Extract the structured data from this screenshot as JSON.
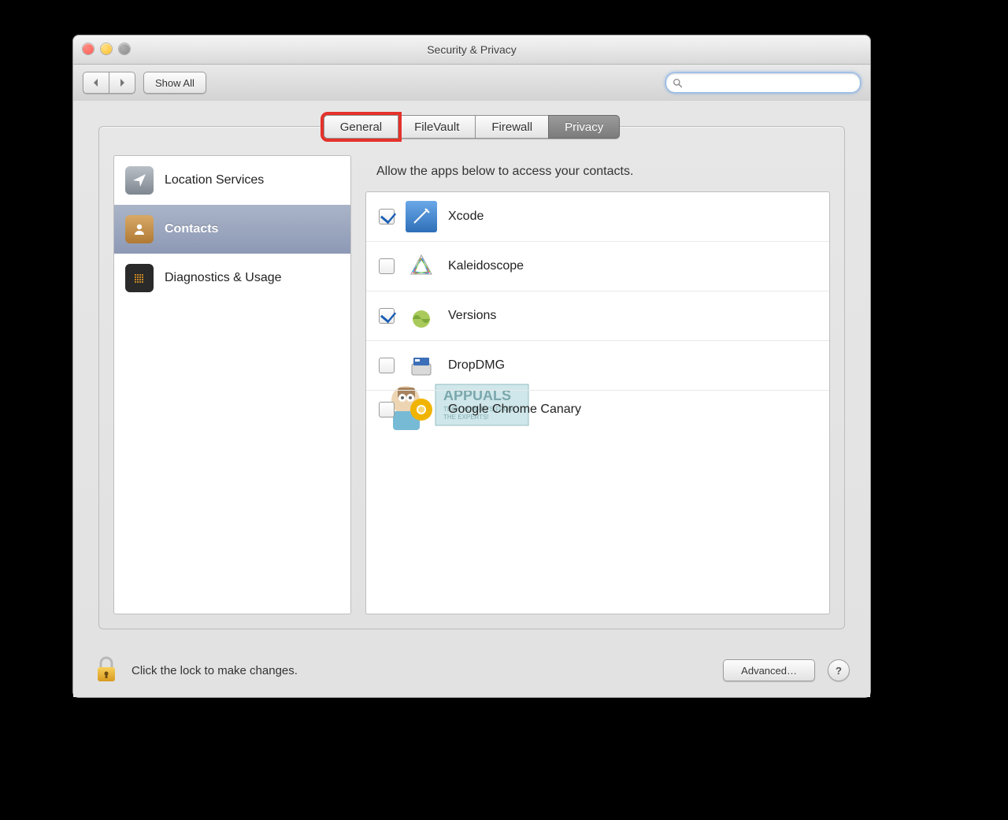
{
  "window": {
    "title": "Security & Privacy"
  },
  "toolbar": {
    "show_all_label": "Show All",
    "search_placeholder": ""
  },
  "tabs": [
    {
      "label": "General",
      "highlighted": true,
      "active": false
    },
    {
      "label": "FileVault",
      "highlighted": false,
      "active": false
    },
    {
      "label": "Firewall",
      "highlighted": false,
      "active": false
    },
    {
      "label": "Privacy",
      "highlighted": false,
      "active": true
    }
  ],
  "sidebar": {
    "items": [
      {
        "label": "Location Services",
        "selected": false,
        "icon": "location"
      },
      {
        "label": "Contacts",
        "selected": true,
        "icon": "contacts"
      },
      {
        "label": "Diagnostics & Usage",
        "selected": false,
        "icon": "diagnostics"
      }
    ]
  },
  "detail": {
    "title": "Allow the apps below to access your contacts.",
    "apps": [
      {
        "name": "Xcode",
        "checked": true,
        "icon_color": "#3b82d6"
      },
      {
        "name": "Kaleidoscope",
        "checked": false,
        "icon_color": "#7ac943"
      },
      {
        "name": "Versions",
        "checked": true,
        "icon_color": "#8bbf3d"
      },
      {
        "name": "DropDMG",
        "checked": false,
        "icon_color": "#4a6fb5"
      },
      {
        "name": "Google Chrome Canary",
        "checked": false,
        "icon_color": "#f0b400"
      }
    ]
  },
  "footer": {
    "lock_text": "Click the lock to make changes.",
    "advanced_label": "Advanced…"
  },
  "watermark": {
    "brand": "APPUALS",
    "tagline1": "TECH HOW-TO'S FROM",
    "tagline2": "THE EXPERTS!"
  }
}
